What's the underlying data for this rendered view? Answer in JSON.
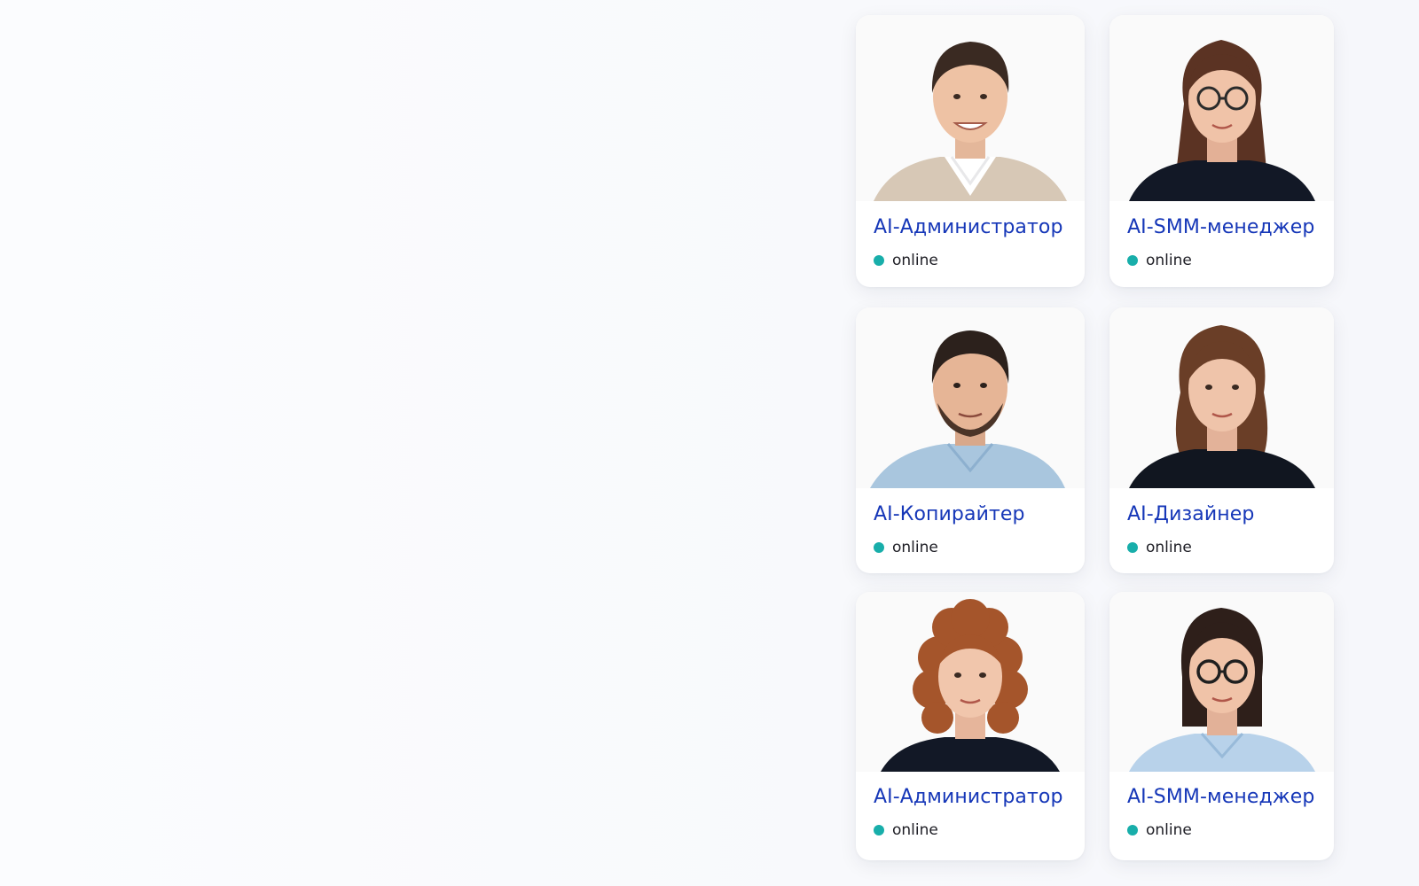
{
  "colors": {
    "accent": "#1637b8",
    "online": "#18aeaa",
    "card_background": "#ffffff",
    "page_background": "#f9fafc"
  },
  "cards": [
    {
      "name": "AI-Администратор",
      "status": "online",
      "avatar": "avatar-man-beige-jacket-icon"
    },
    {
      "name": "AI-SMM-менеджер",
      "status": "online",
      "avatar": "avatar-woman-glasses-long-hair-icon"
    },
    {
      "name": "AI-Копирайтер",
      "status": "online",
      "avatar": "avatar-man-beard-blue-shirt-icon"
    },
    {
      "name": "AI-Дизайнер",
      "status": "online",
      "avatar": "avatar-woman-long-brown-hair-icon"
    },
    {
      "name": "AI-Администратор",
      "status": "online",
      "avatar": "avatar-woman-curly-hair-icon"
    },
    {
      "name": "AI-SMM-менеджер",
      "status": "online",
      "avatar": "avatar-woman-bob-glasses-icon"
    }
  ]
}
